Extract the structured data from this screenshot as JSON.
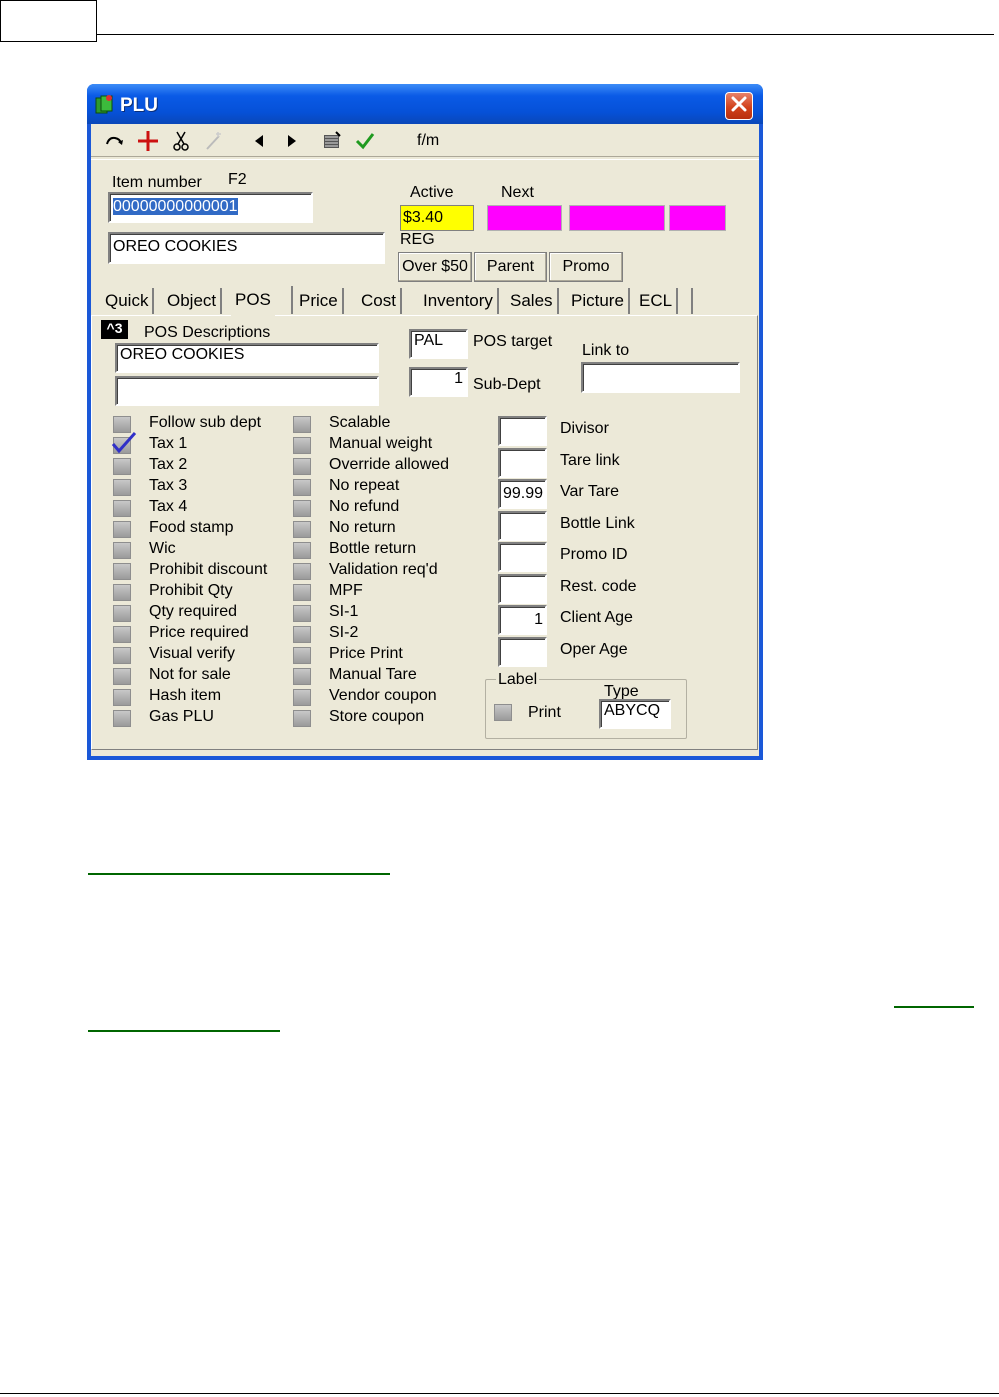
{
  "document": {},
  "window": {
    "title": "PLU"
  },
  "toolbar": {
    "buttons": [
      {
        "name": "refresh-icon"
      },
      {
        "name": "add-icon"
      },
      {
        "name": "cut-icon"
      },
      {
        "name": "wand-icon"
      },
      {
        "name": "prev-icon"
      },
      {
        "name": "next-icon"
      },
      {
        "name": "scan-icon"
      },
      {
        "name": "check-icon"
      }
    ],
    "fm_label": "f/m"
  },
  "header": {
    "item_number_label": "Item number",
    "f2_label": "F2",
    "item_number_value": "00000000000001",
    "description_value": "OREO COOKIES",
    "active_label": "Active",
    "next_label": "Next",
    "active_price": "$3.40",
    "reg_label": "REG",
    "buttons": {
      "over50": "Over $50",
      "parent": "Parent",
      "promo": "Promo"
    },
    "colors": {
      "active": "#ffff00",
      "next": "#ff00ff"
    }
  },
  "tabs": [
    "Quick",
    "Object",
    "POS",
    "Price",
    "Cost",
    "Inventory",
    "Sales",
    "Picture",
    "ECL"
  ],
  "active_tab": "POS",
  "pos": {
    "badge": "^3",
    "descriptions_label": "POS Descriptions",
    "description1": "OREO COOKIES",
    "description2": "",
    "pos_target_value": "PAL",
    "pos_target_label": "POS target",
    "sub_dept_value": "1",
    "sub_dept_label": "Sub-Dept",
    "link_to_label": "Link to",
    "link_to_value": "",
    "left_checks": [
      {
        "label": "Follow sub dept",
        "checked": false
      },
      {
        "label": "Tax 1",
        "checked": true
      },
      {
        "label": "Tax 2",
        "checked": false
      },
      {
        "label": "Tax 3",
        "checked": false
      },
      {
        "label": "Tax 4",
        "checked": false
      },
      {
        "label": "Food stamp",
        "checked": false
      },
      {
        "label": "Wic",
        "checked": false
      },
      {
        "label": "Prohibit discount",
        "checked": false
      },
      {
        "label": "Prohibit Qty",
        "checked": false
      },
      {
        "label": "Qty required",
        "checked": false
      },
      {
        "label": "Price required",
        "checked": false
      },
      {
        "label": "Visual verify",
        "checked": false
      },
      {
        "label": "Not for sale",
        "checked": false
      },
      {
        "label": "Hash item",
        "checked": false
      },
      {
        "label": "Gas PLU",
        "checked": false
      }
    ],
    "mid_checks": [
      {
        "label": "Scalable",
        "checked": false
      },
      {
        "label": "Manual weight",
        "checked": false
      },
      {
        "label": "Override allowed",
        "checked": false
      },
      {
        "label": "No repeat",
        "checked": false
      },
      {
        "label": "No refund",
        "checked": false
      },
      {
        "label": "No return",
        "checked": false
      },
      {
        "label": "Bottle return",
        "checked": false
      },
      {
        "label": "Validation req'd",
        "checked": false
      },
      {
        "label": "MPF",
        "checked": false
      },
      {
        "label": "SI-1",
        "checked": false
      },
      {
        "label": "SI-2",
        "checked": false
      },
      {
        "label": "Price Print",
        "checked": false
      },
      {
        "label": "Manual Tare",
        "checked": false
      },
      {
        "label": "Vendor coupon",
        "checked": false
      },
      {
        "label": "Store coupon",
        "checked": false
      }
    ],
    "right_fields": [
      {
        "label": "Divisor",
        "value": ""
      },
      {
        "label": "Tare link",
        "value": ""
      },
      {
        "label": "Var Tare",
        "value": "99.99"
      },
      {
        "label": "Bottle Link",
        "value": ""
      },
      {
        "label": "Promo ID",
        "value": ""
      },
      {
        "label": "Rest. code",
        "value": ""
      },
      {
        "label": "Client Age",
        "value": "1"
      },
      {
        "label": "Oper Age",
        "value": ""
      }
    ],
    "label_group": {
      "title": "Label",
      "print_label": "Print",
      "type_label": "Type",
      "type_value": "ABYCQ"
    }
  }
}
